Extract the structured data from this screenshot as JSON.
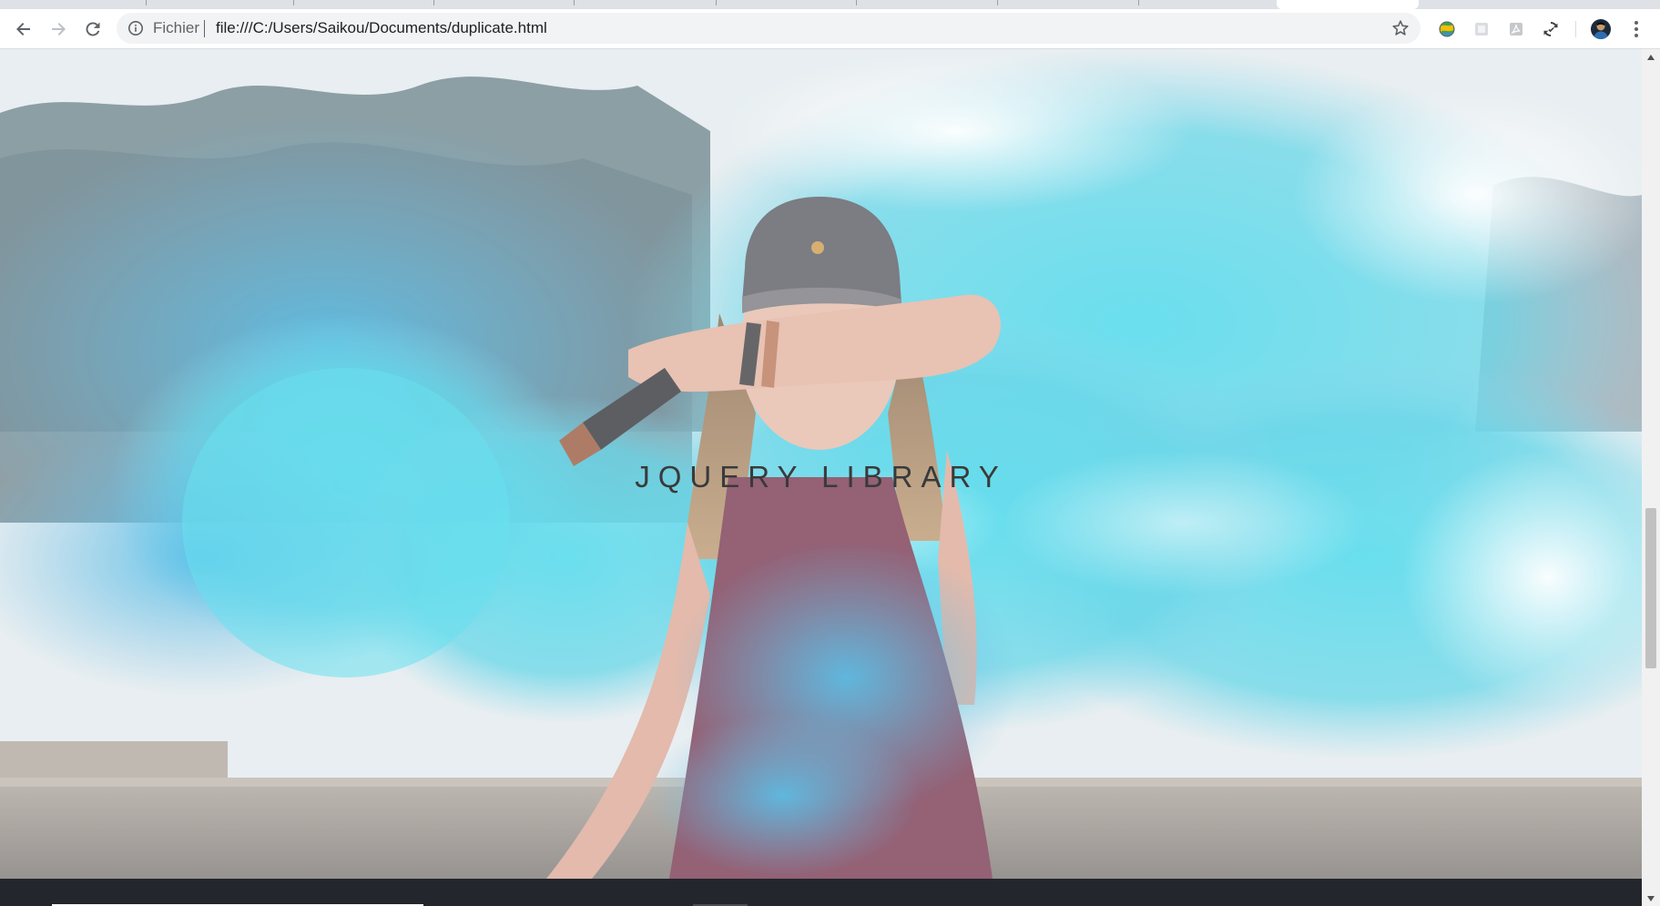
{
  "browser": {
    "omnibox": {
      "scheme_label": "Fichier",
      "url": "file:///C:/Users/Saikou/Documents/duplicate.html"
    },
    "toolbar_icons": [
      "back-icon",
      "forward-icon",
      "reload-icon",
      "info-icon",
      "bookmark-star-icon",
      "extension-icon",
      "extension-icon",
      "extension-icon",
      "sync-icon",
      "profile-avatar",
      "menu-icon"
    ]
  },
  "page": {
    "hero_title": "JQUERY LIBRARY"
  },
  "scroll": {
    "position_fraction": 0.56
  }
}
